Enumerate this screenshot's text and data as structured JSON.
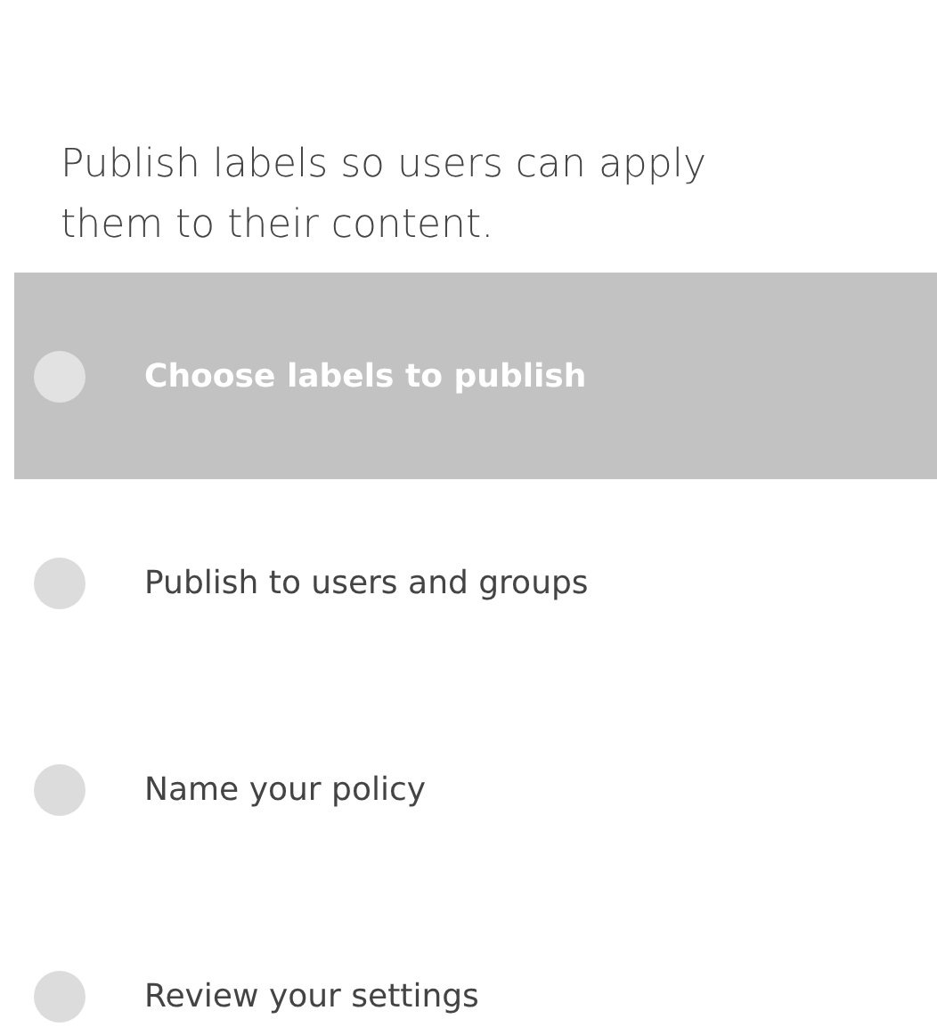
{
  "description": "Publish labels so users can apply them to their content.",
  "steps": [
    {
      "label": "Choose labels to publish",
      "selected": true
    },
    {
      "label": "Publish to users and groups",
      "selected": false
    },
    {
      "label": "Name your policy",
      "selected": false
    },
    {
      "label": "Review your settings",
      "selected": false
    }
  ]
}
